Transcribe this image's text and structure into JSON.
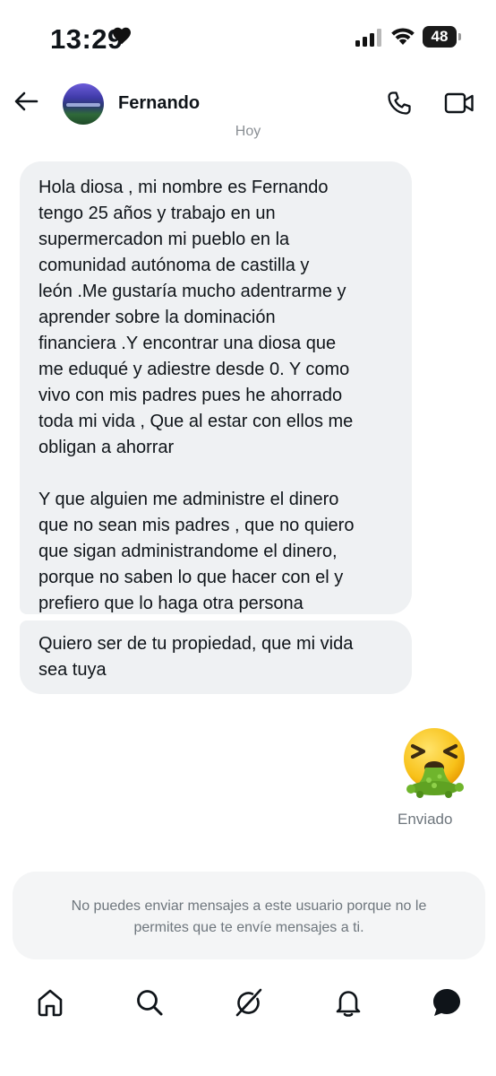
{
  "status_bar": {
    "time": "13:29",
    "battery": "48"
  },
  "header": {
    "contact_name": "Fernando"
  },
  "conversation": {
    "day_label": "Hoy",
    "messages": [
      {
        "paragraphs": [
          [
            "Hola diosa , mi nombre es Fernando",
            "tengo 25 años y trabajo en un",
            "supermercadon mi  pueblo en la",
            "comunidad autónoma de castilla y",
            "león .Me gustaría mucho adentrarme y",
            "aprender sobre la dominación",
            "financiera .Y encontrar una diosa que",
            "me eduqué y adiestre desde 0. Y como",
            "vivo con mis padres pues he ahorrado",
            "toda mi vida , Que al estar con ellos me",
            "obligan a ahorrar"
          ],
          [
            "Y que alguien me administre el dinero",
            "que no sean mis padres , que no quiero",
            "que sigan administrandome el dinero,",
            "porque no saben lo que hacer con el  y",
            "prefiero que lo haga otra persona"
          ]
        ]
      },
      {
        "lines": [
          "Quiero ser de tu propiedad, que mi vida",
          "sea tuya"
        ]
      }
    ],
    "sent_sticker": "nauseated-vomiting-face-emoji",
    "sent_status": "Enviado"
  },
  "notice": {
    "line1": "No puedes enviar mensajes a este usuario porque no le",
    "line2": "permites que te envíe mensajes a ti."
  },
  "bottom_nav": {
    "items": [
      "home-icon",
      "search-icon",
      "grok-icon",
      "notifications-icon",
      "messages-icon"
    ],
    "active": "messages-icon"
  }
}
